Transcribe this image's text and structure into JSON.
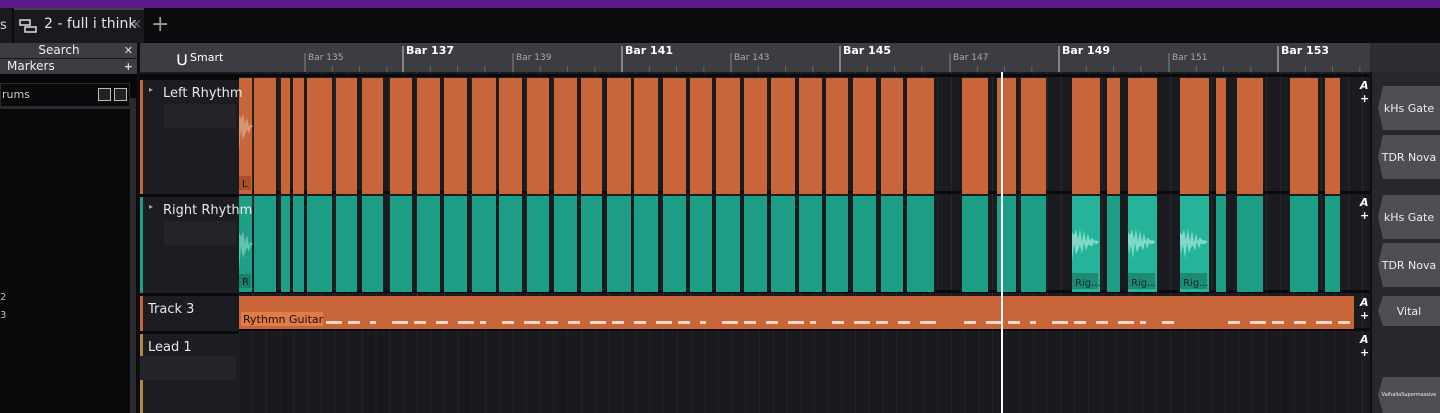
{
  "tabs": {
    "stub_label": "s",
    "active_label": "2 - full i think",
    "close_glyph": "×",
    "add_glyph": "+"
  },
  "browser": {
    "search_label": "Search",
    "markers_label": "Markers",
    "close_glyph": "✕",
    "add_glyph": "+",
    "folder_path": "rums",
    "list_numbers": [
      "2",
      "3"
    ]
  },
  "ruler": {
    "smart_label": "Smart",
    "bars": [
      {
        "label": "Bar 135",
        "major": false
      },
      {
        "label": "Bar 137",
        "major": true
      },
      {
        "label": "Bar 139",
        "major": false
      },
      {
        "label": "Bar 141",
        "major": true
      },
      {
        "label": "Bar 143",
        "major": false
      },
      {
        "label": "Bar 145",
        "major": true
      },
      {
        "label": "Bar 147",
        "major": false
      },
      {
        "label": "Bar 149",
        "major": true
      },
      {
        "label": "Bar 151",
        "major": false
      },
      {
        "label": "Bar 153",
        "major": true
      }
    ]
  },
  "tracks": [
    {
      "name": "Left Rhythm",
      "color": "#c8663a",
      "clip_label": "L",
      "fx": [
        "kHs Gate",
        "TDR Nova"
      ]
    },
    {
      "name": "Right Rhythm",
      "color": "#1f9e87",
      "clip_label": "R",
      "region_labels": [
        "Rig...",
        "Rig...",
        "Rig..."
      ],
      "fx": [
        "kHs Gate",
        "TDR Nova"
      ]
    },
    {
      "name": "Track 3",
      "color": "#c8663a",
      "clip_label": "Rythmn Guitar",
      "fx": [
        "Vital"
      ]
    },
    {
      "name": "Lead 1",
      "color": "#b08a3a",
      "fx": [
        "ValhallaSupermassive"
      ]
    }
  ],
  "automation": {
    "a_label": "A",
    "plus_label": "+"
  },
  "icons": [
    "magnet-icon",
    "tab-track-icon",
    "folder-up-icon",
    "folder-icon",
    "expand-arrow-icon"
  ]
}
